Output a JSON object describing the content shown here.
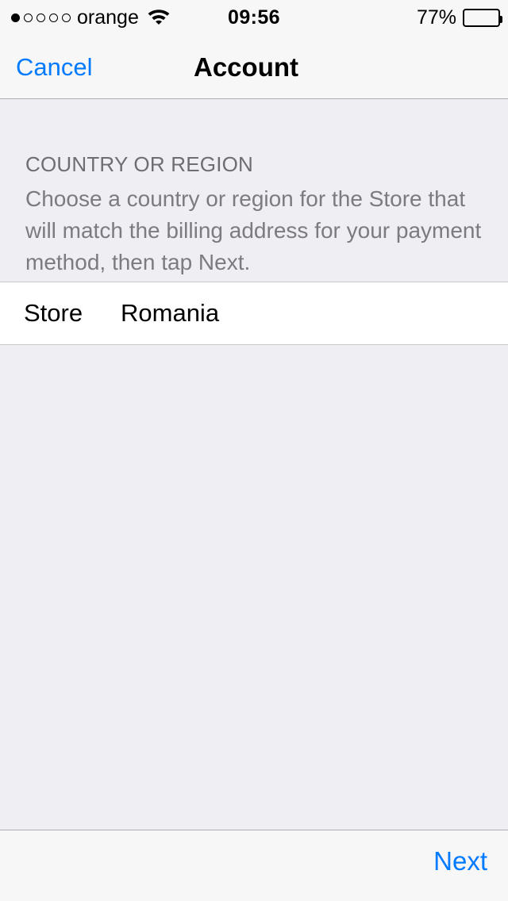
{
  "status_bar": {
    "signal_dots_total": 5,
    "signal_dots_filled": 1,
    "carrier": "orange",
    "wifi_icon": "wifi-icon",
    "time": "09:56",
    "battery_percent_label": "77%",
    "battery_level": 77
  },
  "nav_bar": {
    "cancel_label": "Cancel",
    "title": "Account",
    "tint_color": "#007AFF"
  },
  "content": {
    "section_header": "COUNTRY OR REGION",
    "section_description": "Choose a country or region for the Store that will match the billing address for your payment method, then tap Next.",
    "store_row": {
      "label": "Store",
      "value": "Romania"
    }
  },
  "toolbar": {
    "next_label": "Next"
  },
  "colors": {
    "tint": "#007AFF",
    "background": "#EFEEF2",
    "bar_background": "#F7F7F7",
    "row_background": "#FFFFFF",
    "secondary_text": "#6D6D72",
    "separator": "#C8C7CC"
  }
}
